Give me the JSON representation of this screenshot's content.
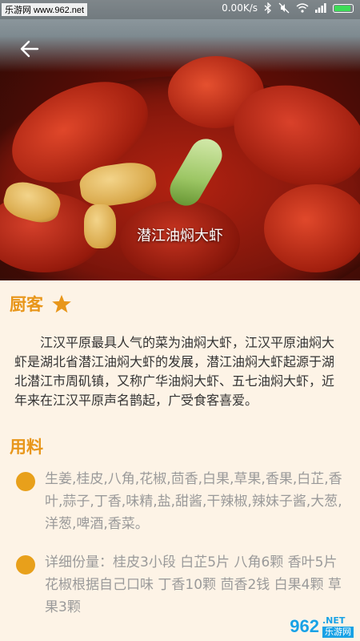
{
  "status_bar": {
    "site_label": "乐游网 www.962.net",
    "net_speed": "0.00K/s",
    "battery_level": 0.85,
    "icons": [
      "bluetooth-icon",
      "mute-icon",
      "wifi-icon",
      "signal-icon",
      "battery-icon"
    ]
  },
  "hero": {
    "caption": "潜江油焖大虾",
    "back_icon": "arrow-left-icon"
  },
  "chef": {
    "title": "厨客",
    "star_icon": "star-icon",
    "description": "江汉平原最具人气的菜为油焖大虾，江汉平原油焖大虾是湖北省潜江油焖大虾的发展，潜江油焖大虾起源于湖北潜江市周矶镇，又称广华油焖大虾、五七油焖大虾，近年来在江汉平原声名鹊起，广受食客喜爱。"
  },
  "ingredients": {
    "title": "用料",
    "items": [
      "生姜,桂皮,八角,花椒,茴香,白果,草果,香果,白芷,香叶,蒜子,丁香,味精,盐,甜酱,干辣椒,辣妹子酱,大葱,洋葱,啤酒,香菜。",
      "详细份量：桂皮3小段 白芷5片 八角6颗 香叶5片 花椒根据自己口味 丁香10颗 茴香2钱 白果4颗 草果3颗"
    ]
  },
  "watermark": {
    "logo": "962",
    "domain": ".NET",
    "brand": "乐游网"
  },
  "colors": {
    "accent": "#e8961a",
    "dot": "#e8a01b",
    "background": "#fdf3e6"
  }
}
